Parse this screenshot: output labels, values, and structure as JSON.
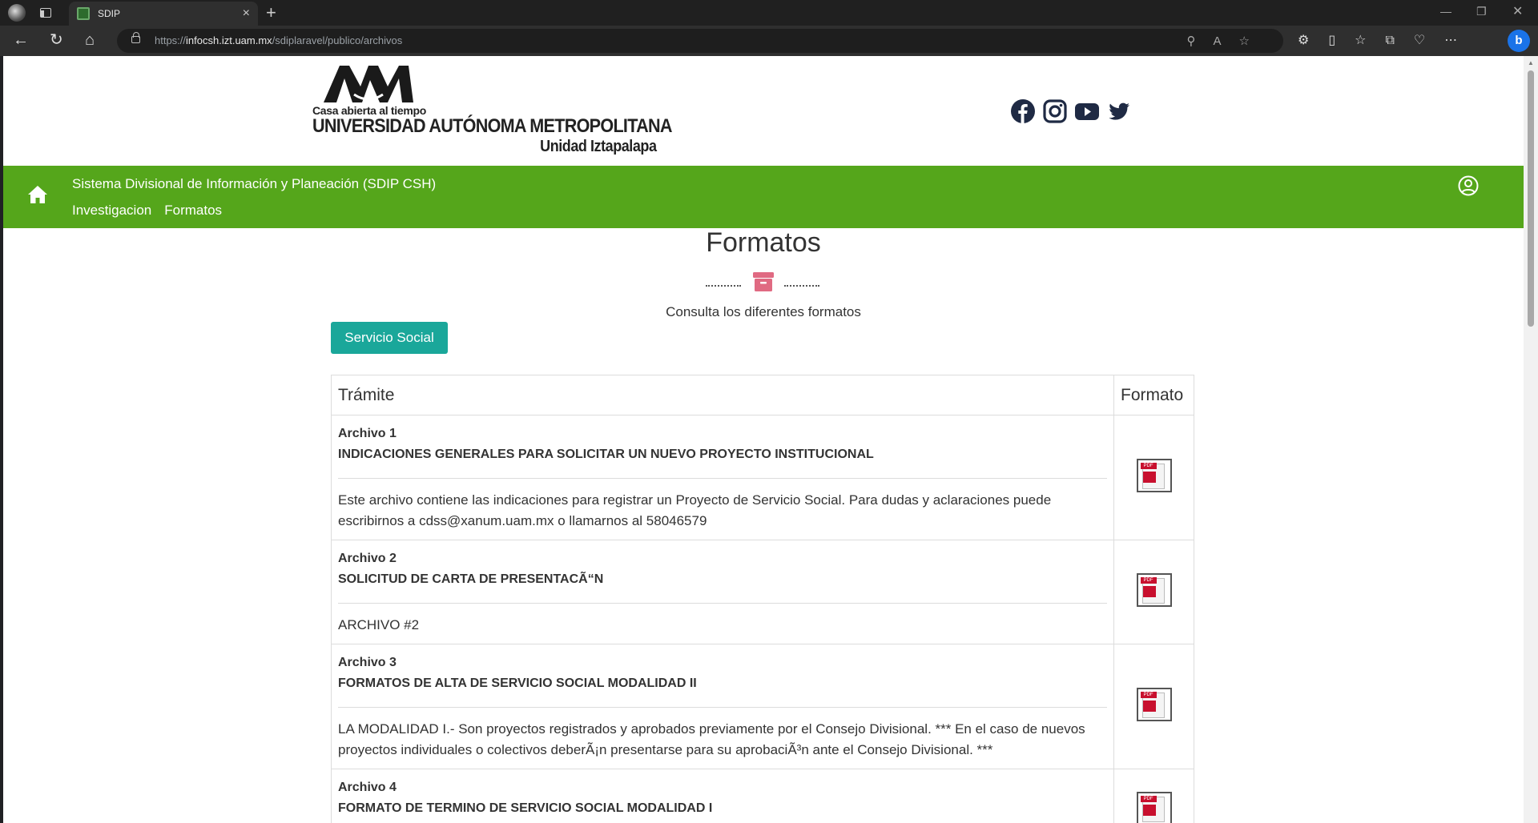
{
  "browser": {
    "tab_title": "SDIP",
    "url_prefix": "https://",
    "url_domain": "infocsh.izt.uam.mx",
    "url_path": "/sdiplaravel/publico/archivos",
    "new_tab_symbol": "+",
    "close_symbol": "×"
  },
  "header": {
    "logo_line1": "Casa abierta al tiempo",
    "logo_line2": "UNIVERSIDAD AUTÓNOMA METROPOLITANA",
    "logo_line3": "Unidad Iztapalapa",
    "social": [
      "facebook-icon",
      "instagram-icon",
      "youtube-icon",
      "twitter-icon"
    ]
  },
  "nav": {
    "title": "Sistema Divisional de Información y Planeación (SDIP CSH)",
    "links": [
      "Investigacion",
      "Formatos"
    ],
    "bar_color": "#55a61b"
  },
  "main": {
    "title": "Formatos",
    "subtitle": "Consulta los diferentes formatos",
    "category_button": "Servicio Social",
    "category_color": "#1aa79a",
    "accent_color": "#e06a82"
  },
  "table": {
    "headers": [
      "Trámite",
      "Formato"
    ],
    "rows": [
      {
        "number": "Archivo 1",
        "name": "INDICACIONES GENERALES PARA SOLICITAR UN NUEVO PROYECTO INSTITUCIONAL",
        "description": "Este archivo contiene las indicaciones para registrar un Proyecto de Servicio Social. Para dudas y aclaraciones puede escribirnos a cdss@xanum.uam.mx o llamarnos al 58046579",
        "pdf_label": "PDF"
      },
      {
        "number": "Archivo 2",
        "name": "SOLICITUD DE CARTA DE PRESENTACÃ“N",
        "description": "ARCHIVO #2",
        "pdf_label": "PDF"
      },
      {
        "number": "Archivo 3",
        "name": "FORMATOS DE ALTA DE SERVICIO SOCIAL MODALIDAD II",
        "description": "LA MODALIDAD I.- Son proyectos registrados y aprobados previamente por el Consejo Divisional. *** En el caso de nuevos proyectos individuales o colectivos deberÃ¡n presentarse para su aprobaciÃ³n ante el Consejo Divisional. ***",
        "pdf_label": "PDF"
      },
      {
        "number": "Archivo 4",
        "name": "FORMATO DE TERMINO DE SERVICIO SOCIAL MODALIDAD I",
        "description": "",
        "pdf_label": "PDF"
      }
    ]
  }
}
